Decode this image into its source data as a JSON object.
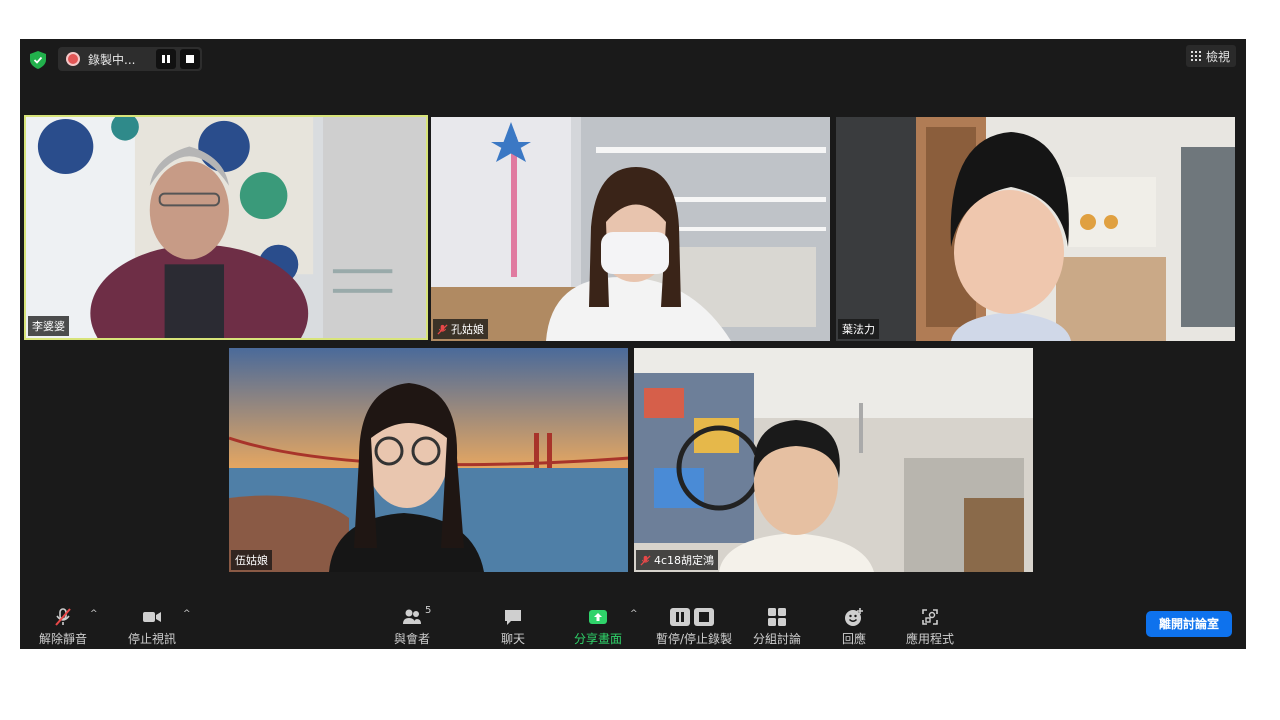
{
  "top_bar": {
    "recording_status": "錄製中...",
    "view_label": "檢視"
  },
  "participants": [
    {
      "name": "李婆婆",
      "muted": false,
      "active_speaker": true
    },
    {
      "name": "孔姑娘",
      "muted": true,
      "active_speaker": false
    },
    {
      "name": "葉法力",
      "muted": false,
      "active_speaker": false
    },
    {
      "name": "伍姑娘",
      "muted": false,
      "active_speaker": false
    },
    {
      "name": "4c18胡定鴻",
      "muted": true,
      "active_speaker": false
    }
  ],
  "toolbar": {
    "unmute_label": "解除靜音",
    "stop_video_label": "停止視訊",
    "participants_label": "與會者",
    "participants_count": "5",
    "chat_label": "聊天",
    "share_label": "分享畫面",
    "record_label": "暫停/停止錄製",
    "breakout_label": "分組討論",
    "reactions_label": "回應",
    "apps_label": "應用程式",
    "leave_label": "離開討論室"
  },
  "colors": {
    "background": "#1a1a1a",
    "active_speaker_border": "#d8e47a",
    "share_green": "#2fd36a",
    "leave_blue": "#0e72ed",
    "recording_red": "#e25656"
  }
}
